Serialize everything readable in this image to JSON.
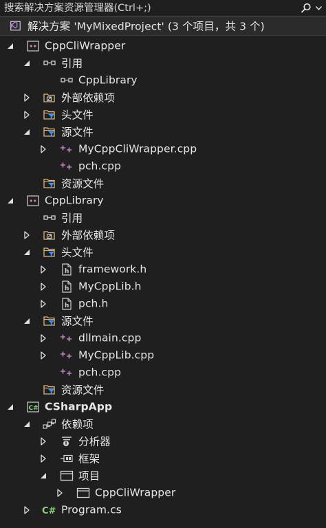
{
  "search": {
    "placeholder": "搜索解决方案资源管理器(Ctrl+;)"
  },
  "colors": {
    "background": "#1f1f1f",
    "text": "#e6e6e6",
    "cpp_accent": "#c586c0",
    "folder": "#dcb67a",
    "filter_blue": "#3794ff",
    "csharp_green": "#8bd07a",
    "solution_purple": "#b180d7"
  },
  "solution": {
    "label": "解决方案 'MyMixedProject' (3 个项目，共 3 个)",
    "icon": "solution-icon"
  },
  "tree": [
    {
      "id": "cppcli",
      "level": 0,
      "toggle": "expanded",
      "icon": "cpp-project-icon",
      "label": "CppCliWrapper",
      "bold": false
    },
    {
      "id": "cppcli-refs",
      "level": 1,
      "toggle": "expanded",
      "icon": "reference-icon",
      "label": "引用",
      "bold": false
    },
    {
      "id": "cppcli-refs-lib",
      "level": 2,
      "toggle": "none",
      "icon": "reference-icon",
      "label": "CppLibrary",
      "bold": false
    },
    {
      "id": "cppcli-ext",
      "level": 1,
      "toggle": "collapsed",
      "icon": "external-deps-icon",
      "label": "外部依赖项",
      "bold": false
    },
    {
      "id": "cppcli-headers",
      "level": 1,
      "toggle": "collapsed",
      "icon": "filter-folder-icon",
      "label": "头文件",
      "bold": false
    },
    {
      "id": "cppcli-sources",
      "level": 1,
      "toggle": "expanded",
      "icon": "filter-folder-icon",
      "label": "源文件",
      "bold": false
    },
    {
      "id": "cppcli-src-main",
      "level": 2,
      "toggle": "collapsed",
      "icon": "cpp-file-icon",
      "label": "MyCppCliWrapper.cpp",
      "bold": false
    },
    {
      "id": "cppcli-src-pch",
      "level": 2,
      "toggle": "none",
      "icon": "cpp-file-icon",
      "label": "pch.cpp",
      "bold": false
    },
    {
      "id": "cppcli-res",
      "level": 1,
      "toggle": "none",
      "icon": "filter-folder-icon",
      "label": "资源文件",
      "bold": false
    },
    {
      "id": "cpplib",
      "level": 0,
      "toggle": "expanded",
      "icon": "cpp-project-icon",
      "label": "CppLibrary",
      "bold": false
    },
    {
      "id": "cpplib-refs",
      "level": 1,
      "toggle": "none",
      "icon": "reference-icon",
      "label": "引用",
      "bold": false
    },
    {
      "id": "cpplib-ext",
      "level": 1,
      "toggle": "collapsed",
      "icon": "external-deps-icon",
      "label": "外部依赖项",
      "bold": false
    },
    {
      "id": "cpplib-headers",
      "level": 1,
      "toggle": "expanded",
      "icon": "filter-folder-icon",
      "label": "头文件",
      "bold": false
    },
    {
      "id": "cpplib-h-fw",
      "level": 2,
      "toggle": "collapsed",
      "icon": "header-file-icon",
      "label": "framework.h",
      "bold": false
    },
    {
      "id": "cpplib-h-lib",
      "level": 2,
      "toggle": "collapsed",
      "icon": "header-file-icon",
      "label": "MyCppLib.h",
      "bold": false
    },
    {
      "id": "cpplib-h-pch",
      "level": 2,
      "toggle": "collapsed",
      "icon": "header-file-icon",
      "label": "pch.h",
      "bold": false
    },
    {
      "id": "cpplib-sources",
      "level": 1,
      "toggle": "expanded",
      "icon": "filter-folder-icon",
      "label": "源文件",
      "bold": false
    },
    {
      "id": "cpplib-src-dll",
      "level": 2,
      "toggle": "collapsed",
      "icon": "cpp-file-icon",
      "label": "dllmain.cpp",
      "bold": false
    },
    {
      "id": "cpplib-src-lib",
      "level": 2,
      "toggle": "collapsed",
      "icon": "cpp-file-icon",
      "label": "MyCppLib.cpp",
      "bold": false
    },
    {
      "id": "cpplib-src-pch",
      "level": 2,
      "toggle": "none",
      "icon": "cpp-file-icon",
      "label": "pch.cpp",
      "bold": false
    },
    {
      "id": "cpplib-res",
      "level": 1,
      "toggle": "none",
      "icon": "filter-folder-icon",
      "label": "资源文件",
      "bold": false
    },
    {
      "id": "csharp",
      "level": 0,
      "toggle": "expanded",
      "icon": "csharp-project-icon",
      "label": "CSharpApp",
      "bold": true
    },
    {
      "id": "csharp-deps",
      "level": 1,
      "toggle": "expanded",
      "icon": "dependencies-icon",
      "label": "依赖项",
      "bold": false
    },
    {
      "id": "csharp-deps-analyzer",
      "level": 2,
      "toggle": "collapsed",
      "icon": "analyzer-icon",
      "label": "分析器",
      "bold": false
    },
    {
      "id": "csharp-deps-fw",
      "level": 2,
      "toggle": "collapsed",
      "icon": "framework-icon",
      "label": "框架",
      "bold": false
    },
    {
      "id": "csharp-deps-proj",
      "level": 2,
      "toggle": "expanded",
      "icon": "project-ref-icon",
      "label": "项目",
      "bold": false
    },
    {
      "id": "csharp-deps-proj-cli",
      "level": 3,
      "toggle": "collapsed",
      "icon": "project-ref-icon",
      "label": "CppCliWrapper",
      "bold": false
    },
    {
      "id": "csharp-program",
      "level": 1,
      "toggle": "collapsed",
      "icon": "csharp-file-icon",
      "label": "Program.cs",
      "bold": false
    }
  ]
}
